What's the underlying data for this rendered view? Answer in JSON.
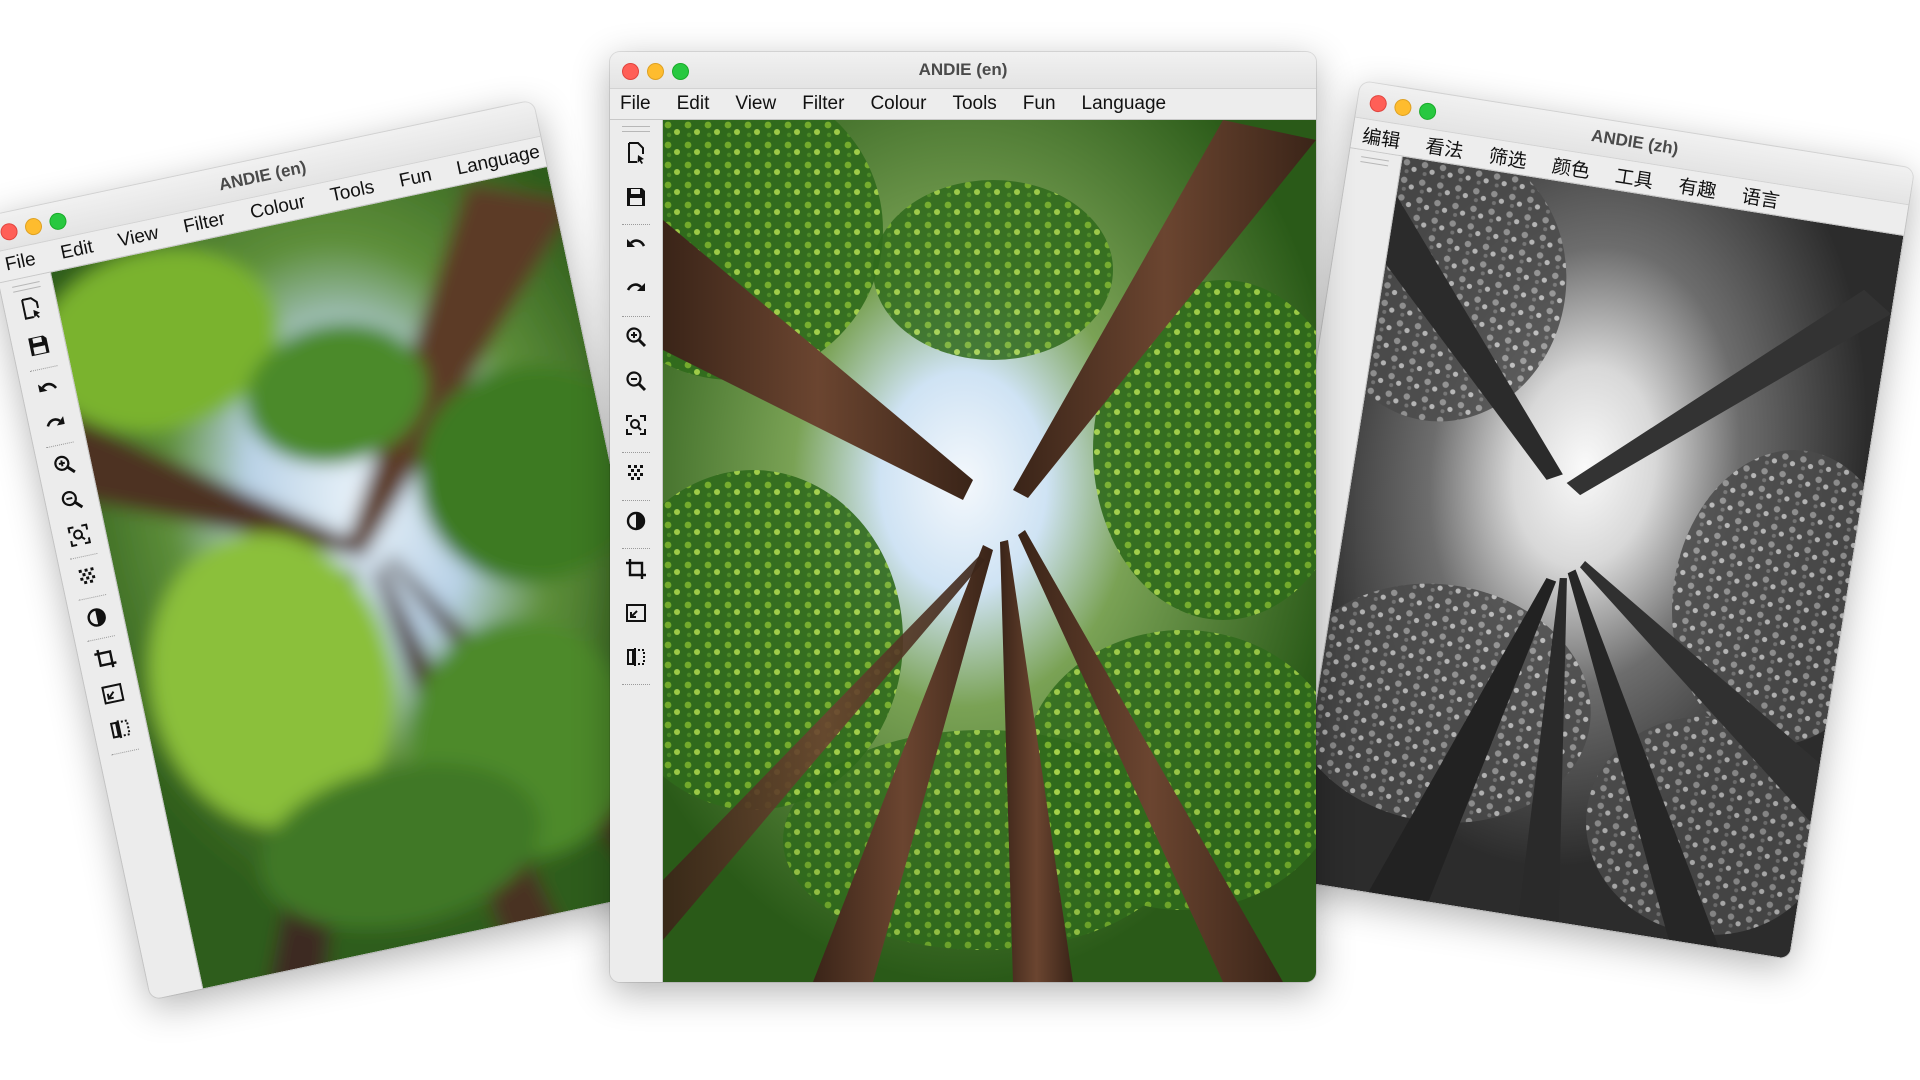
{
  "windows": {
    "left": {
      "title": "ANDIE (en)",
      "menu": [
        "File",
        "Edit",
        "View",
        "Filter",
        "Colour",
        "Tools",
        "Fun",
        "Language"
      ]
    },
    "center": {
      "title": "ANDIE (en)",
      "menu": [
        "File",
        "Edit",
        "View",
        "Filter",
        "Colour",
        "Tools",
        "Fun",
        "Language"
      ]
    },
    "right": {
      "title": "ANDIE (zh)",
      "menu": [
        "编辑",
        "看法",
        "筛选",
        "颜色",
        "工具",
        "有趣",
        "语言"
      ]
    }
  },
  "toolbar_icons": [
    "open-file-icon",
    "save-icon",
    "undo-icon",
    "redo-icon",
    "zoom-in-icon",
    "zoom-out-icon",
    "zoom-fit-icon",
    "pixelate-icon",
    "contrast-icon",
    "crop-icon",
    "resize-icon",
    "flip-icon"
  ],
  "image_variants": {
    "left": "blurred color forest canopy",
    "center": "color forest canopy",
    "right": "greyscale forest canopy"
  },
  "colors": {
    "close": "#ff5f57",
    "minimize": "#febc2e",
    "maximize": "#28c840",
    "foliage": "#3f7d22",
    "sky": "#cfe3f4",
    "trunk": "#5a3a2a"
  }
}
